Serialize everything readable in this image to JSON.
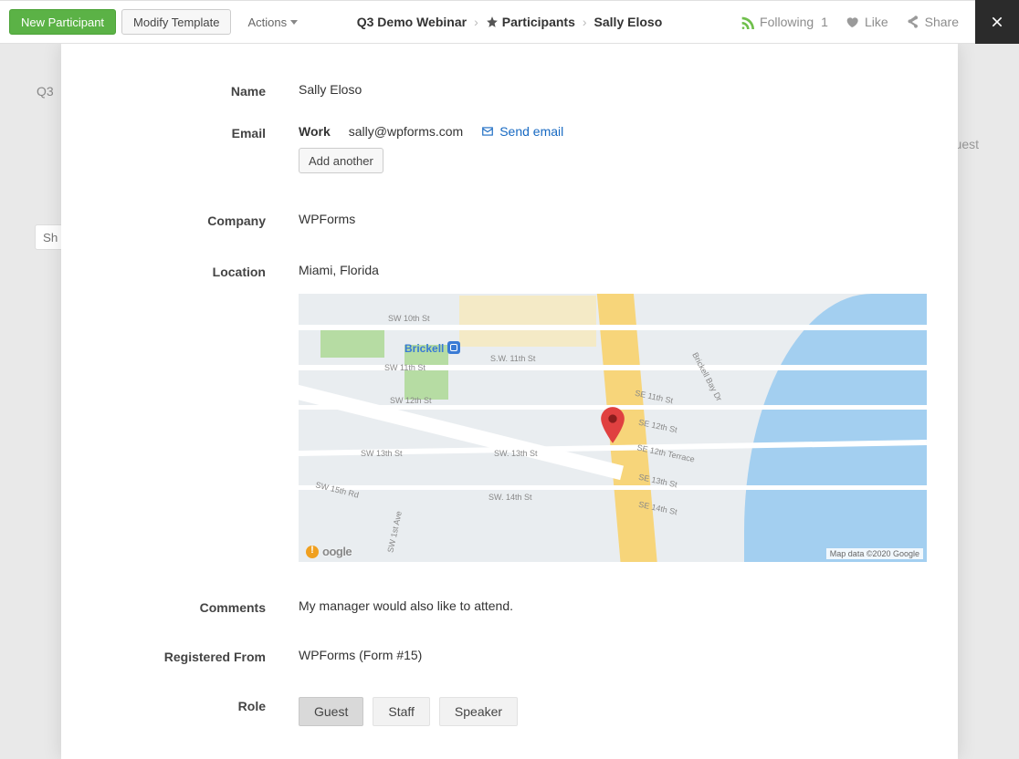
{
  "toolbar": {
    "new_participant": "New Participant",
    "modify_template": "Modify Template",
    "actions": "Actions"
  },
  "breadcrumb": {
    "root": "Q3 Demo Webinar",
    "section": "Participants",
    "current": "Sally Eloso"
  },
  "social": {
    "following_label": "Following",
    "following_count": "1",
    "like_label": "Like",
    "share_label": "Share"
  },
  "bg": {
    "q3": "Q3",
    "search_placeholder": "Sh",
    "guest_badge": "uest"
  },
  "fields": {
    "name_label": "Name",
    "name_value": "Sally Eloso",
    "email_label": "Email",
    "email_type": "Work",
    "email_value": "sally@wpforms.com",
    "send_email": "Send email",
    "add_another": "Add another",
    "company_label": "Company",
    "company_value": "WPForms",
    "location_label": "Location",
    "location_value": "Miami, Florida",
    "comments_label": "Comments",
    "comments_value": "My manager would also like to attend.",
    "registered_from_label": "Registered From",
    "registered_from_value": "WPForms (Form #15)",
    "role_label": "Role"
  },
  "roles": {
    "guest": "Guest",
    "staff": "Staff",
    "speaker": "Speaker"
  },
  "map": {
    "brickell": "Brickell",
    "credit": "Map data ©2020 Google",
    "logo_text": "oogle",
    "streets": {
      "sw10": "SW 10th St",
      "sw11l": "SW 11th St",
      "sw11r": "S.W. 11th St",
      "sw12": "SW 12th St",
      "sw13l": "SW 13th St",
      "sw13r": "SW. 13th St",
      "sw14": "SW. 14th St",
      "sw15rd": "SW 15th Rd",
      "sw1ave": "SW 1st Ave",
      "se11": "SE 11th St",
      "se12": "SE 12th St",
      "se12t": "SE 12th Terrace",
      "se13": "SE 13th St",
      "se14": "SE 14th St",
      "baydr": "Brickell Bay Dr"
    }
  }
}
